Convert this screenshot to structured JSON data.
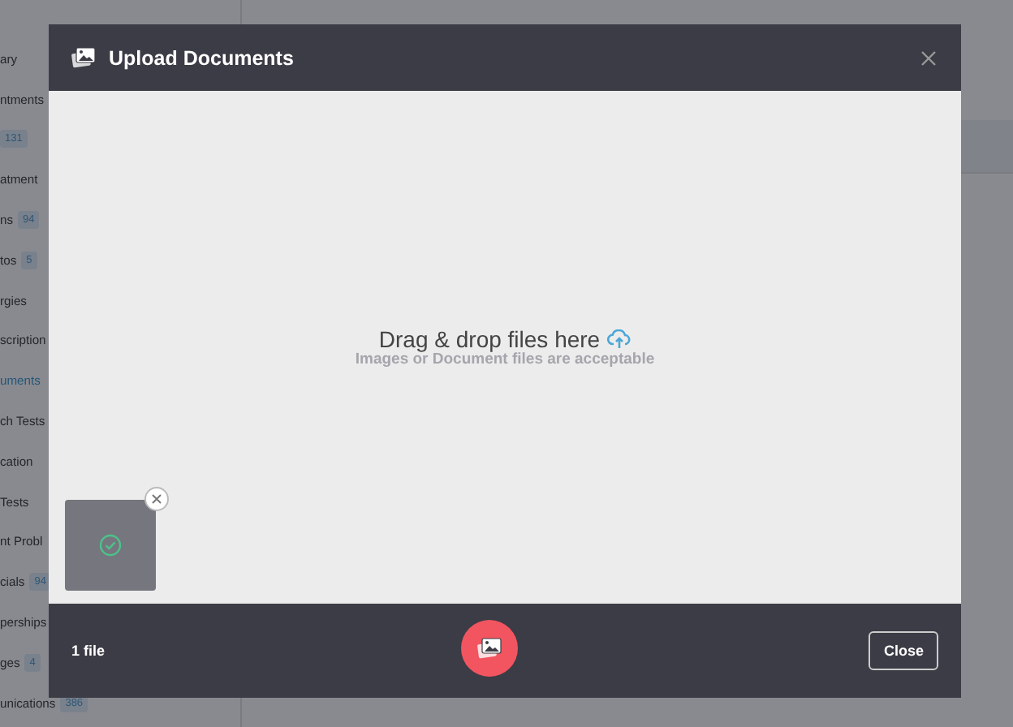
{
  "sidebar": {
    "items": [
      {
        "label": "ary",
        "selected": false
      },
      {
        "label": "ntments",
        "selected": false
      },
      {
        "badge": "131"
      },
      {
        "label": "atment",
        "selected": false
      },
      {
        "label": "ns",
        "badge": "94",
        "selected": false
      },
      {
        "label": "tos",
        "badge": "5",
        "selected": false
      },
      {
        "label": "rgies",
        "selected": false
      },
      {
        "label": "scription",
        "selected": false
      },
      {
        "label": "uments",
        "selected": true
      },
      {
        "label": "ch Tests",
        "selected": false
      },
      {
        "label": "cation",
        "selected": false
      },
      {
        "label": "Tests",
        "selected": false
      },
      {
        "label": "nt Probl",
        "selected": false
      },
      {
        "label": "cials",
        "badge": "94",
        "selected": false
      },
      {
        "label": "perships",
        "selected": false
      },
      {
        "label": "ges",
        "badge": "4",
        "selected": false
      },
      {
        "label": "unications",
        "badge": "386",
        "selected": false
      }
    ]
  },
  "dialog": {
    "title": "Upload Documents",
    "dropzone": {
      "title": "Drag & drop files here",
      "hint": "Images or Document files are acceptable"
    },
    "files": [
      {
        "uploaded": true
      }
    ],
    "footer": {
      "count": "1 file",
      "close_button": "Close"
    }
  }
}
